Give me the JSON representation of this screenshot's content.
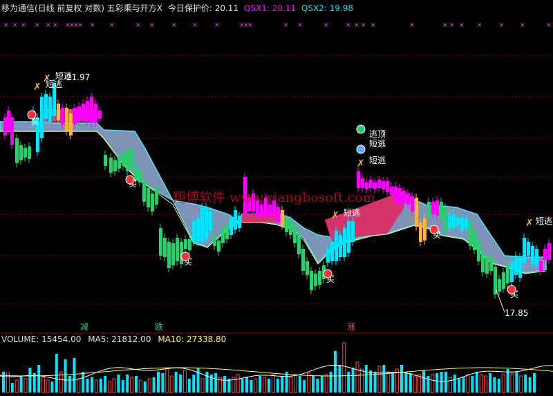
{
  "header": {
    "title": "移为通信(日线 前复权 对数) 五彩乘与开方X",
    "price_label": "今日保护价: 20.11",
    "qsx1": "QSX1: 20.11",
    "qsx2": "QSX2: 19.98"
  },
  "volume_header": {
    "volume": "VOLUME: 15454.00",
    "ma5": "MA5: 21812.00",
    "ma10": "MA10: 27338.80"
  },
  "watermark": "翔博软件 www.xiangbosoft.com",
  "annotations": {
    "short_escape": "短逃",
    "top_escape": "逃顶",
    "buy": "买",
    "high_value": "21.97",
    "low_value": "17.85",
    "axis_jian": "减",
    "axis_die": "跌",
    "axis_zhang": "涨"
  },
  "colors": {
    "bull": "#00e5ff",
    "bear": "#2ecc71",
    "magenta": "#ff00ff",
    "pink_cloud": "#d6336c",
    "blue_cloud": "#7f93b8",
    "orange": "#ffb347",
    "grid": "#8b0000",
    "ma_line": "#ffff66"
  },
  "chart_data": {
    "type": "candlestick",
    "price_range": [
      17.5,
      22.5
    ],
    "high_marked": 21.97,
    "low_marked": 17.85,
    "protect_price": 20.11,
    "qsx1": 20.11,
    "qsx2": 19.98,
    "volume": 15454.0,
    "ma5": 21812.0,
    "ma10": 27338.8
  }
}
